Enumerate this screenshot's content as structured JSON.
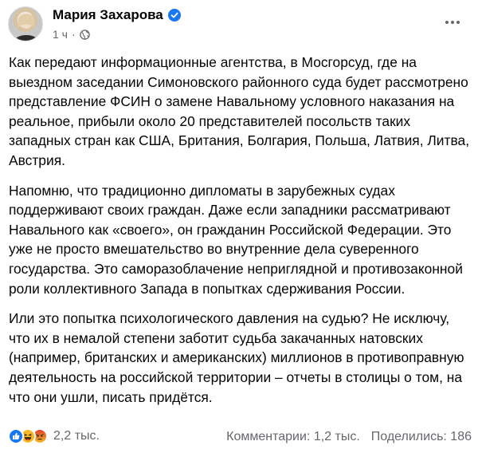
{
  "post": {
    "author": "Мария Захарова",
    "time": "1 ч",
    "separator": "·",
    "paragraphs": [
      "Как передают информационные агентства, в Мосгорсуд, где на выездном заседании Симоновского районного суда будет рассмотрено представление ФСИН о замене Навальному условного наказания на реальное, прибыли около 20 представителей посольств таких западных стран как США, Британия, Болгария, Польша, Латвия, Литва, Австрия.",
      "Напомню, что традиционно дипломаты в зарубежных судах поддерживают своих граждан. Даже если западники рассматривают Навального как «своего», он гражданин Российской Федерации. Это уже не просто вмешательство во внутренние дела суверенного государства. Это саморазоблачение неприглядной и противозаконной роли коллективного Запада в попытках сдерживания России.",
      "Или это попытка психологического давления на судью?  Не исключу, что их в немалой степени заботит судьба закачанных натовских (например, британских и американских)  миллионов в противоправную деятельность на российской территории – отчеты в столицы о том, на что они ушли, писать придётся."
    ]
  },
  "reactions": {
    "icons": [
      "like-icon",
      "haha-icon",
      "angry-icon"
    ],
    "count": "2,2 тыс."
  },
  "stats": {
    "comments": "Комментарии: 1,2 тыс.",
    "shares": "Поделились: 186"
  },
  "colors": {
    "text": "#050505",
    "secondary": "#65676b",
    "verified": "#1877f2",
    "like": "#1877f2",
    "haha": "#f7b928",
    "angry": "#e9710f"
  }
}
